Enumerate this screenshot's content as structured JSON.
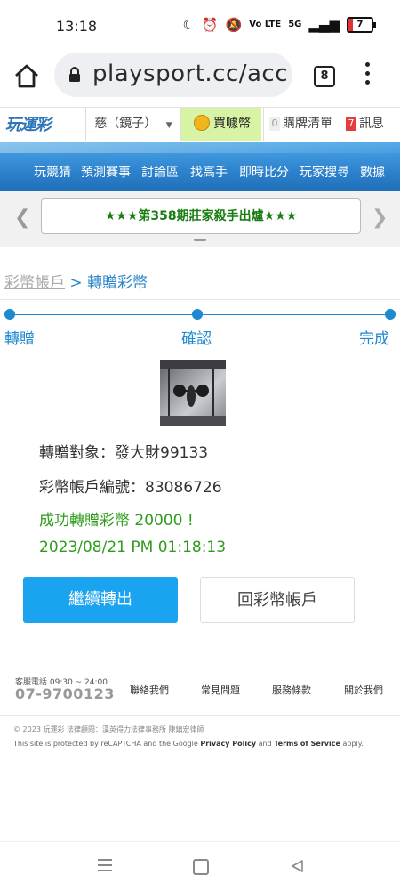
{
  "status_bar": {
    "time": "13:18",
    "battery": "7",
    "network": "5G",
    "volte": "Vo LTE"
  },
  "browser": {
    "url": "playsport.cc/acco",
    "tab_count": "8"
  },
  "site": {
    "logo": "玩運彩",
    "user": "慈（鏡子）",
    "buy_coin": "買噱幣",
    "cart_count": "0",
    "cart_label": "購牌清單",
    "msg_count": "7",
    "msg_label": "訊息"
  },
  "nav": {
    "items": [
      "玩競猜",
      "預測賽事",
      "討論區",
      "找高手",
      "即時比分",
      "玩家搜尋",
      "數據"
    ]
  },
  "announcement": {
    "text": "★★★第358期莊家殺手出爐★★★"
  },
  "breadcrumb": {
    "parent": "彩幣帳戶",
    "separator": ">",
    "current": "轉贈彩幣"
  },
  "steps": {
    "items": [
      "轉贈",
      "確認",
      "完成"
    ]
  },
  "transfer": {
    "recipient": "轉贈對象：發大財99133",
    "account": "彩幣帳戶編號：83086726",
    "success": "成功轉贈彩幣 20000 !",
    "datetime": "2023/08/21 PM 01:18:13"
  },
  "buttons": {
    "continue": "繼續轉出",
    "back": "回彩幣帳戶"
  },
  "footer": {
    "hours": "客服電話 09:30 ~ 24:00",
    "phone": "07-9700123",
    "links": [
      "聯絡我們",
      "常見問題",
      "服務條款",
      "關於我們"
    ],
    "copyright": "© 2023 玩運彩 法律顧問：漢英得力法律事務所 陳鎮宏律師",
    "captcha_prefix": "This site is protected by reCAPTCHA and the Google",
    "privacy": "Privacy Policy",
    "and": "and",
    "terms": "Terms of Service",
    "apply": "apply."
  },
  "colors": {
    "accent": "#1aa3ee",
    "success": "#2e9c1a",
    "nav": "#2f84cf",
    "step": "#1e88d0"
  }
}
